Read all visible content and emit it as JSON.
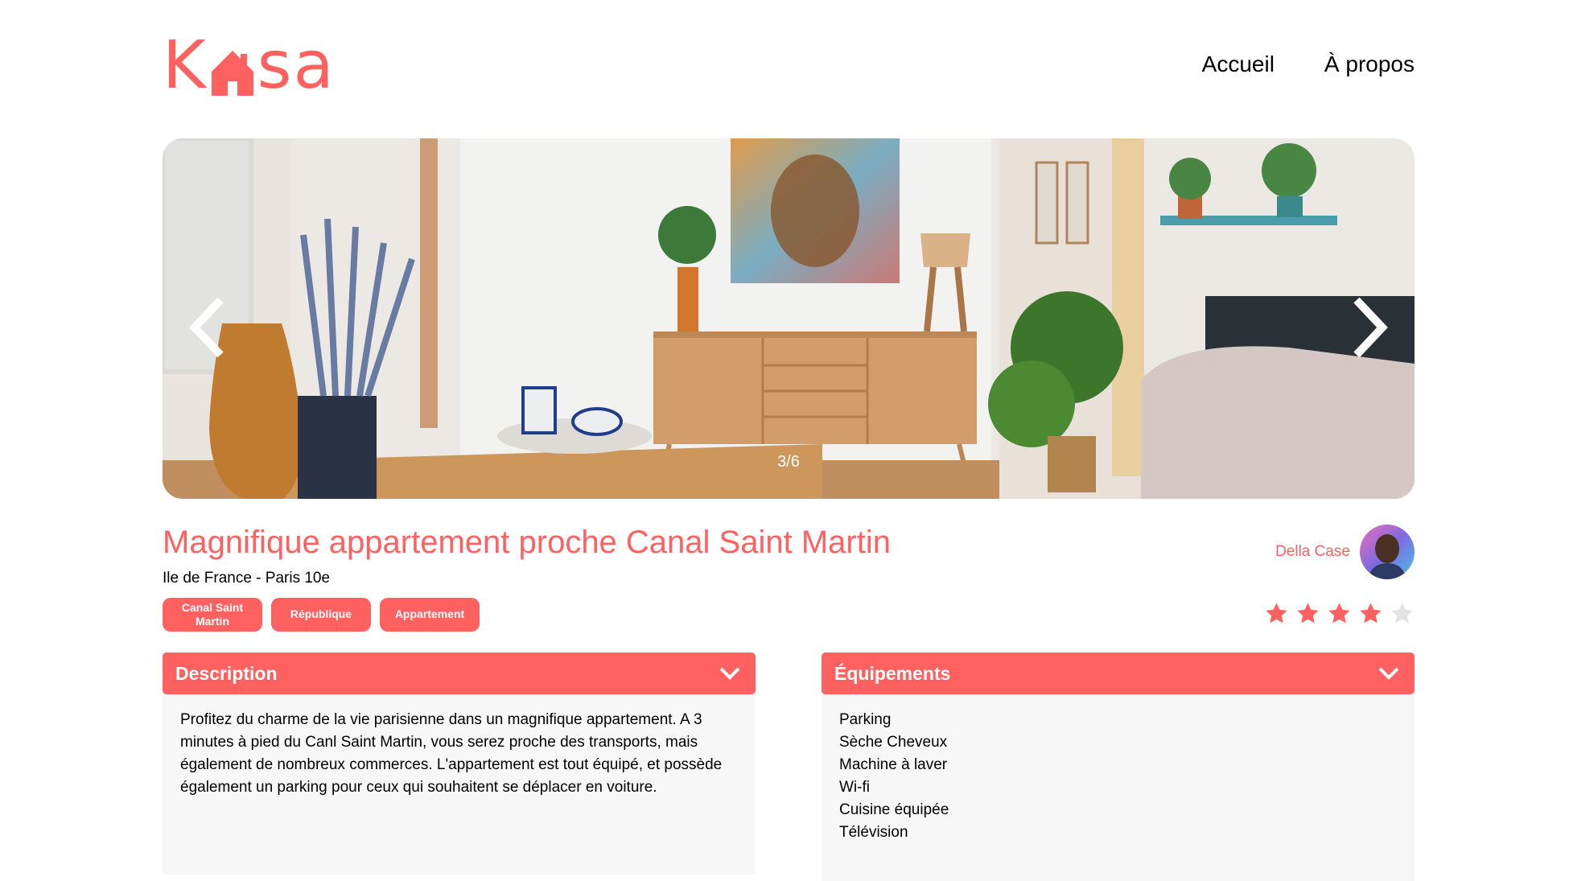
{
  "brand": {
    "logo_text_left": "K",
    "logo_text_right": "sa",
    "accent": "#FF6060"
  },
  "nav": {
    "home": "Accueil",
    "about": "À propos"
  },
  "carousel": {
    "counter": "3/6",
    "prev_icon": "chevron-left-icon",
    "next_icon": "chevron-right-icon"
  },
  "listing": {
    "title": "Magnifique appartement proche Canal Saint Martin",
    "location": "Ile de France - Paris 10e",
    "tags": [
      "Canal Saint Martin",
      "République",
      "Appartement"
    ],
    "host_name": "Della Case",
    "rating": 4,
    "rating_max": 5
  },
  "description": {
    "title": "Description",
    "text": "Profitez du charme de la vie parisienne dans un magnifique appartement. A 3 minutes à pied du Canl Saint Martin, vous serez proche des transports, mais également de nombreux commerces. L'appartement est tout équipé, et possède également un parking pour ceux qui souhaitent se déplacer en voiture."
  },
  "equipments": {
    "title": "Équipements",
    "items": [
      "Parking",
      "Sèche Cheveux",
      "Machine à laver",
      "Wi-fi",
      "Cuisine équipée",
      "Télévision"
    ]
  }
}
